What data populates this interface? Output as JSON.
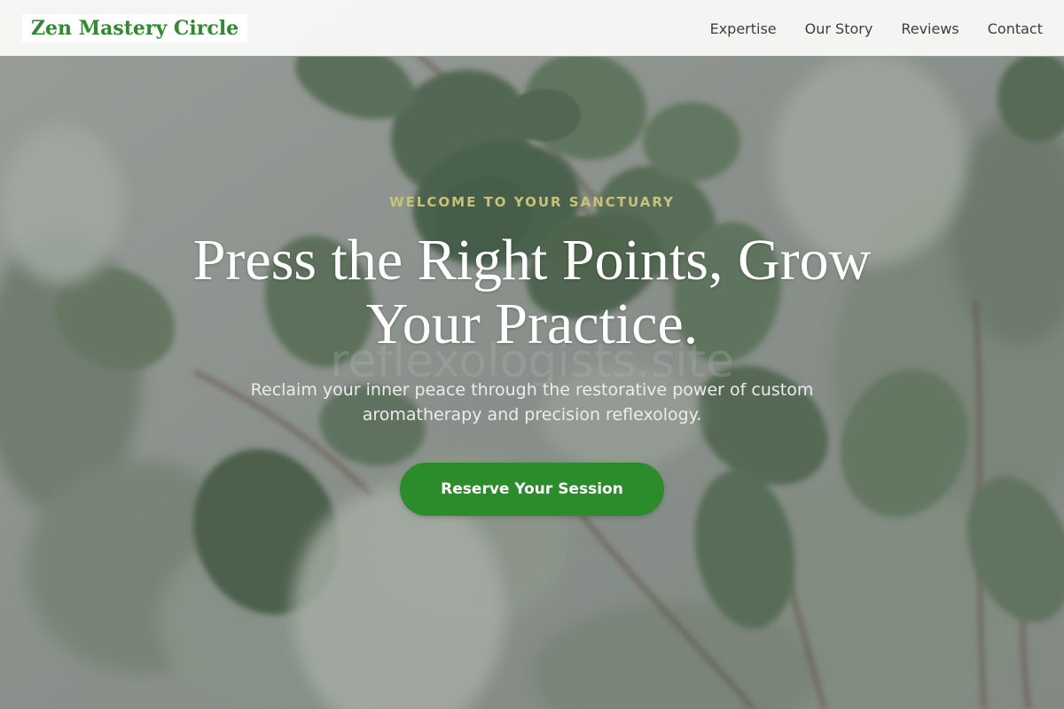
{
  "header": {
    "logo_text": "Zen Mastery Circle",
    "nav": [
      {
        "label": "Expertise"
      },
      {
        "label": "Our Story"
      },
      {
        "label": "Reviews"
      },
      {
        "label": "Contact"
      }
    ]
  },
  "hero": {
    "eyebrow": "WELCOME TO YOUR SANCTUARY",
    "headline": "Press the Right Points, Grow Your Practice.",
    "watermark": "reflexologists.site",
    "subtext": "Reclaim your inner peace through the restorative power of custom aromatherapy and precision reflexology.",
    "cta_label": "Reserve Your Session",
    "background_image": "eucalyptus-leaves"
  },
  "colors": {
    "brand_green": "#2e8b2e",
    "cta_green": "#2a8c2a",
    "eyebrow_gold": "#c8c27a",
    "header_bg": "#f8f9f7"
  }
}
